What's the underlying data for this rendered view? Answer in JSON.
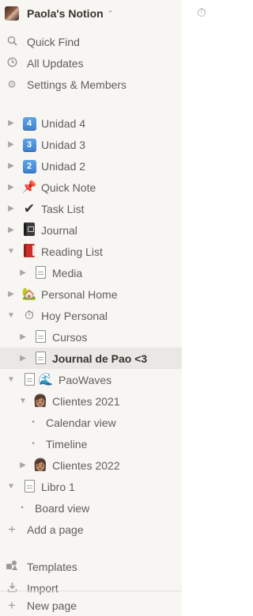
{
  "workspace": {
    "name": "Paola's Notion",
    "chevron_icon": "updown-chevron-icon"
  },
  "utilities": [
    {
      "label": "Quick Find",
      "icon": "search-icon"
    },
    {
      "label": "All Updates",
      "icon": "clock-icon"
    },
    {
      "label": "Settings & Members",
      "icon": "gear-icon"
    }
  ],
  "pages": [
    {
      "label": "Unidad 4",
      "icon": "4"
    },
    {
      "label": "Unidad 3",
      "icon": "3"
    },
    {
      "label": "Unidad 2",
      "icon": "2"
    },
    {
      "label": "Quick Note",
      "icon": "📌"
    },
    {
      "label": "Task List",
      "icon": "✔"
    },
    {
      "label": "Journal",
      "icon": "journal-icon"
    },
    {
      "label": "Reading List",
      "icon": "red-book-icon"
    },
    {
      "label": "Media",
      "icon": "page-icon"
    },
    {
      "label": "Personal Home",
      "icon": "🏡"
    },
    {
      "label": "Hoy Personal",
      "icon": "⏱"
    },
    {
      "label": "Cursos",
      "icon": "page-icon"
    },
    {
      "label": "Journal de Pao <3",
      "icon": "page-icon"
    },
    {
      "label": "PaoWaves",
      "icon": "🌊"
    },
    {
      "label": "Clientes 2021",
      "icon": "👩🏽"
    },
    {
      "label": "Calendar view"
    },
    {
      "label": "Timeline"
    },
    {
      "label": "Clientes 2022",
      "icon": "👩🏽"
    },
    {
      "label": "Libro 1",
      "icon": "page-icon"
    },
    {
      "label": "Board view"
    }
  ],
  "add_page": {
    "label": "Add a page",
    "icon": "plus-icon"
  },
  "templates": {
    "label": "Templates",
    "icon": "templates-icon"
  },
  "import": {
    "label": "Import",
    "icon": "import-icon"
  },
  "new_page": {
    "label": "New page",
    "icon": "plus-icon"
  },
  "main": {
    "icon": "stopwatch-icon",
    "glyph": "⏱"
  }
}
